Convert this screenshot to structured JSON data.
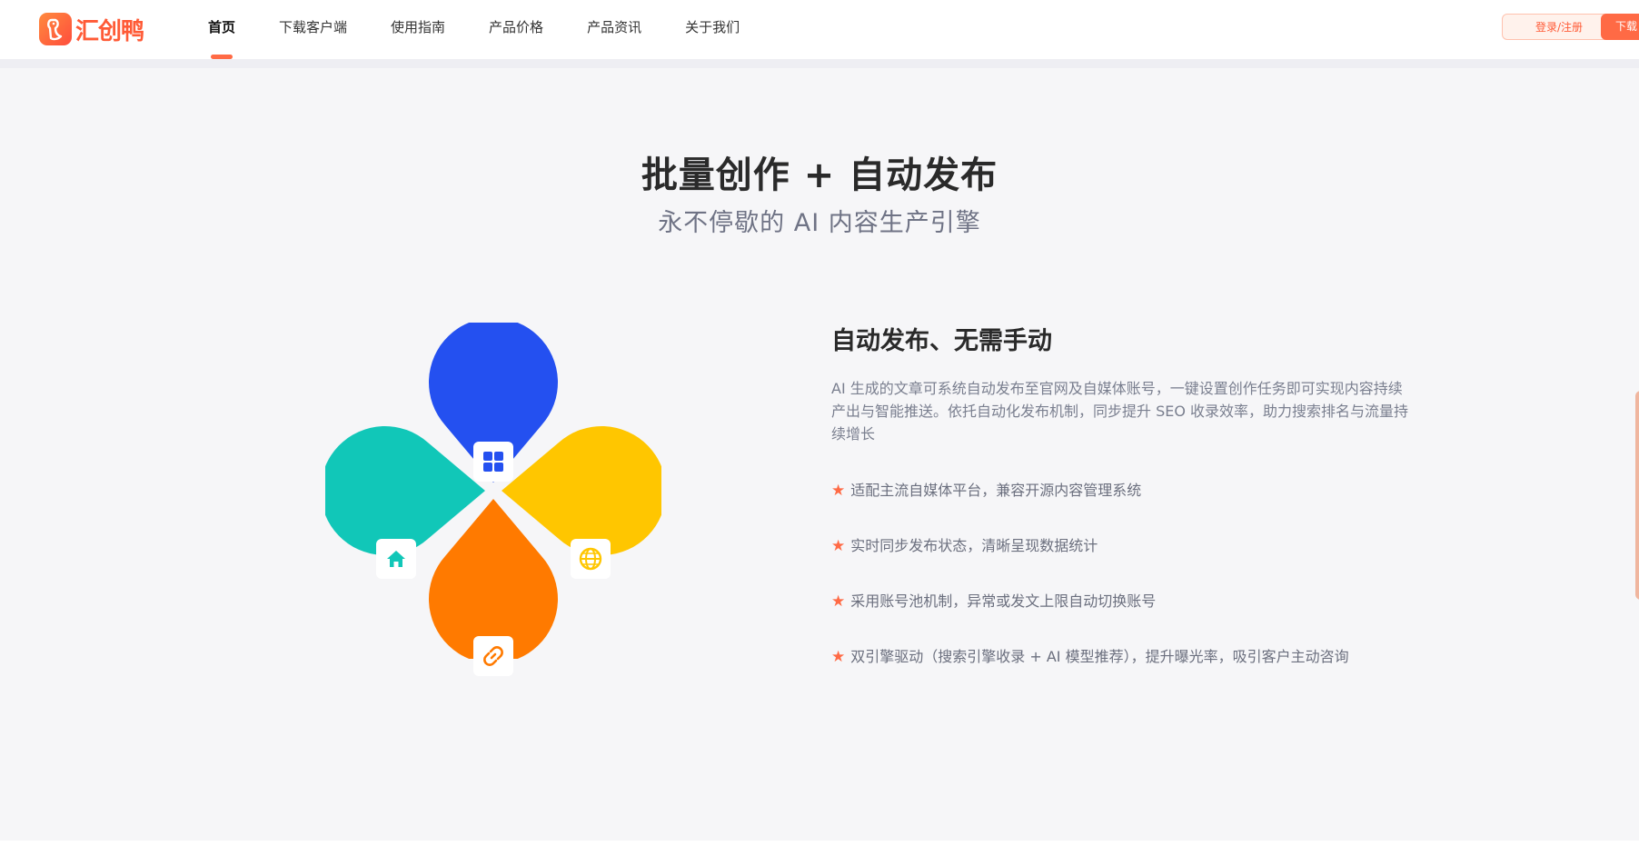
{
  "brand": {
    "name": "汇创鸭",
    "accent": "#ff6a45"
  },
  "nav": {
    "items": [
      {
        "label": "首页",
        "active": true
      },
      {
        "label": "下载客户端",
        "active": false
      },
      {
        "label": "使用指南",
        "active": false
      },
      {
        "label": "产品价格",
        "active": false
      },
      {
        "label": "产品资讯",
        "active": false
      },
      {
        "label": "关于我们",
        "active": false
      }
    ]
  },
  "header": {
    "login_label": "登录/注册",
    "download_label": "下载"
  },
  "hero": {
    "title": "批量创作 + 自动发布",
    "subtitle": "永不停歇的 AI 内容生产引擎"
  },
  "illustration": {
    "petals": [
      {
        "color": "#2450f0",
        "icon": "grid-icon"
      },
      {
        "color": "#ffc600",
        "icon": "globe-icon"
      },
      {
        "color": "#ff7a00",
        "icon": "link-icon"
      },
      {
        "color": "#11c7b8",
        "icon": "home-icon"
      }
    ]
  },
  "feature": {
    "title": "自动发布、无需手动",
    "description": "AI 生成的文章可系统自动发布至官网及自媒体账号，一键设置创作任务即可实现内容持续产出与智能推送。依托自动化发布机制，同步提升 SEO 收录效率，助力搜索排名与流量持续增长",
    "bullets": [
      "适配主流自媒体平台，兼容开源内容管理系统",
      "实时同步发布状态，清晰呈现数据统计",
      "采用账号池机制，异常或发文上限自动切换账号",
      "双引擎驱动（搜索引擎收录 + AI 模型推荐），提升曝光率，吸引客户主动咨询"
    ],
    "bullet_icon": "star-icon"
  }
}
